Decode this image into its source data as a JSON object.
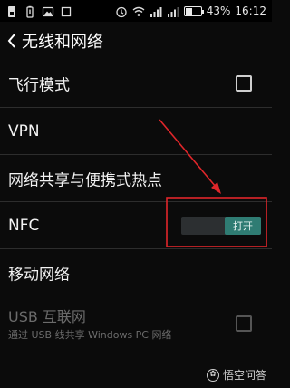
{
  "status_bar": {
    "icons_left": [
      "sim-icon",
      "battery-alert-icon",
      "image-icon",
      "square-icon"
    ],
    "icons_right": [
      "alarm-icon",
      "wifi-icon",
      "signal-icon",
      "signal-icon",
      "battery-icon"
    ],
    "battery_level_percent": 43,
    "battery_text": "43%",
    "time": "16:12"
  },
  "header": {
    "back_icon": "back-chevron-icon",
    "title": "无线和网络"
  },
  "settings": {
    "items": [
      {
        "label": "飞行模式",
        "checked": false
      },
      {
        "label": "VPN"
      },
      {
        "label": "网络共享与便携式热点"
      },
      {
        "label": "NFC",
        "toggle_state": "打开"
      },
      {
        "label": "移动网络"
      },
      {
        "label": "USB 互联网",
        "sub_label": "通过 USB 线共享 Windows PC 网络",
        "checked": false,
        "enabled": false
      }
    ]
  },
  "annotation": {
    "arrow_color": "#e0262a",
    "highlight_color": "#e0262a"
  },
  "watermark": {
    "text": "悟空问答"
  }
}
